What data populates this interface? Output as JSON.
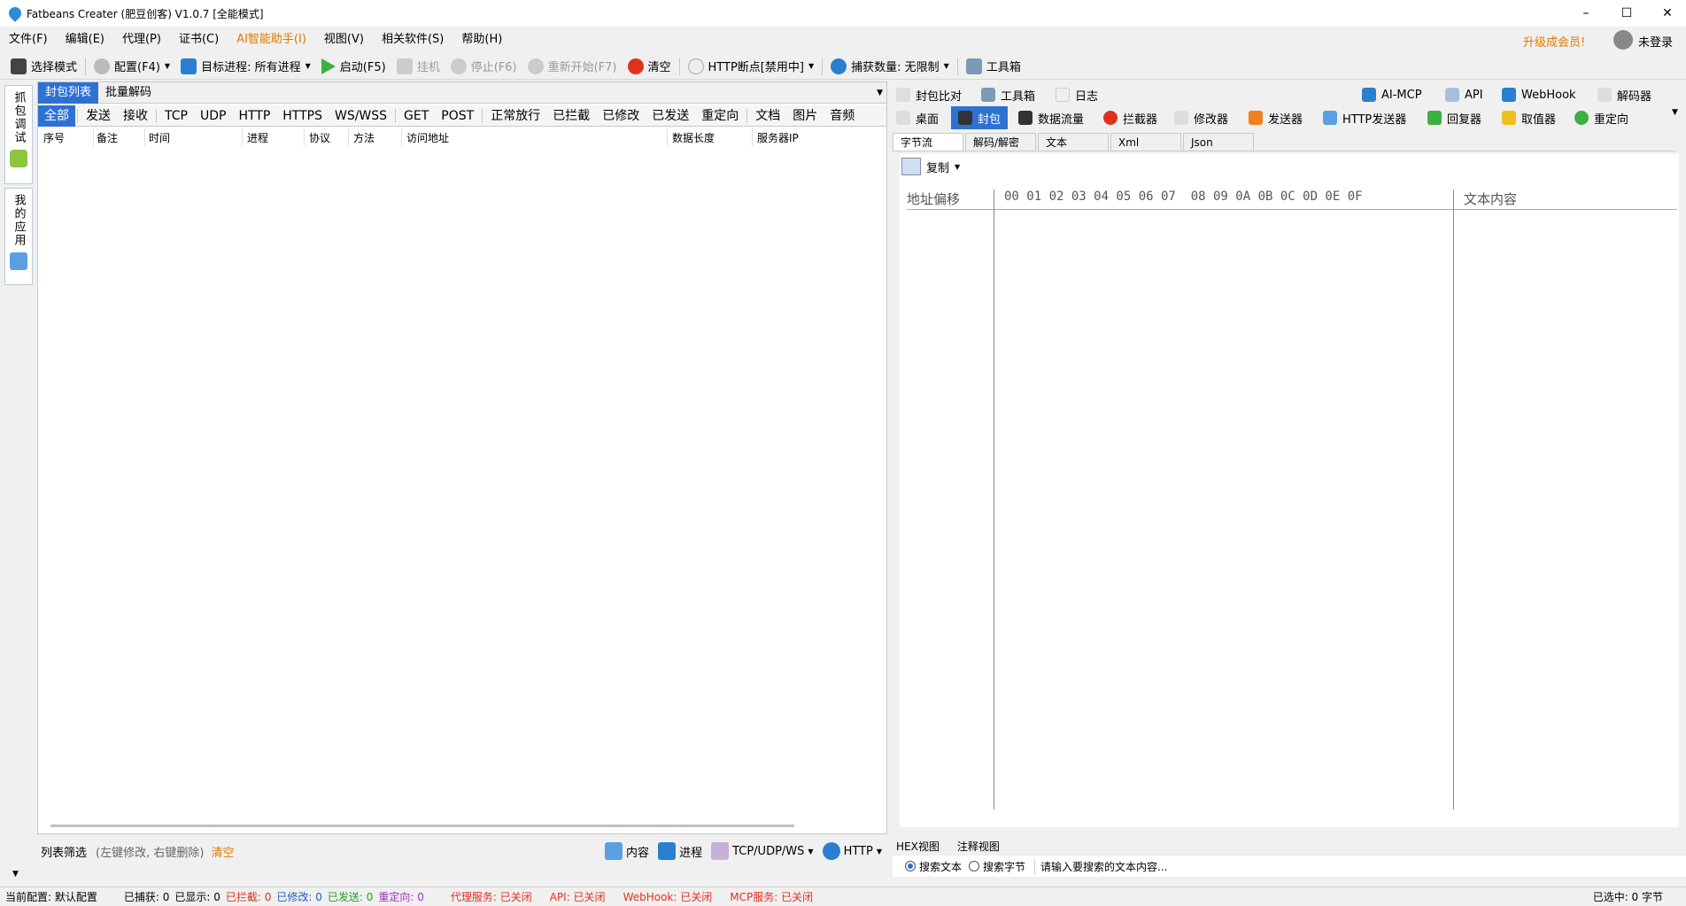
{
  "window": {
    "title": "Fatbeans Creater (肥豆创客) V1.0.7 [全能模式]",
    "min": "–",
    "max": "☐",
    "close": "✕"
  },
  "menu": {
    "items": [
      "文件(F)",
      "编辑(E)",
      "代理(P)",
      "证书(C)",
      "AI智能助手(I)",
      "视图(V)",
      "相关软件(S)",
      "帮助(H)"
    ],
    "upgrade": "升级成会员!",
    "login": "未登录"
  },
  "toolbar": {
    "select_mode": "选择模式",
    "config": "配置(F4)",
    "target_label": "目标进程:",
    "target_value": "所有进程",
    "start": "启动(F5)",
    "hang": "挂机",
    "stop": "停止(F6)",
    "restart": "重新开始(F7)",
    "clear": "清空",
    "http_bp": "HTTP断点[禁用中]",
    "capture_label": "捕获数量:",
    "capture_value": "无限制",
    "toolbox": "工具箱"
  },
  "sidebar": {
    "tab1": "抓包调试",
    "tab2": "我的应用"
  },
  "left": {
    "tabs": [
      "封包列表",
      "批量解码"
    ],
    "filters": [
      "全部",
      "发送",
      "接收",
      "TCP",
      "UDP",
      "HTTP",
      "HTTPS",
      "WS/WSS",
      "GET",
      "POST",
      "正常放行",
      "已拦截",
      "已修改",
      "已发送",
      "重定向",
      "文档",
      "图片",
      "音频"
    ],
    "columns": [
      "序号",
      "备注",
      "时间",
      "进程",
      "协议",
      "方法",
      "访问地址",
      "数据长度",
      "服务器IP"
    ]
  },
  "bottom_filter": {
    "label": "列表筛选",
    "hint": "(左键修改, 右键删除)",
    "clear": "清空",
    "content": "内容",
    "process": "进程",
    "tcp": "TCP/UDP/WS",
    "http": "HTTP"
  },
  "right": {
    "row1": [
      "封包比对",
      "工具箱",
      "日志",
      "AI-MCP",
      "API",
      "WebHook",
      "解码器"
    ],
    "row2": [
      "桌面",
      "封包",
      "数据流量",
      "拦截器",
      "修改器",
      "发送器",
      "HTTP发送器",
      "回复器",
      "取值器",
      "重定向"
    ],
    "tabs": [
      "字节流",
      "解码/解密",
      "文本",
      "Xml",
      "Json"
    ],
    "copy": "复制",
    "hex_header": {
      "addr": "地址偏移",
      "bytes": "00 01 02 03 04 05 06 07  08 09 0A 0B 0C 0D 0E 0F",
      "text": "文本内容"
    },
    "view_tabs": [
      "HEX视图",
      "注释视图"
    ],
    "search_text": "搜索文本",
    "search_bytes": "搜索字节",
    "search_placeholder": "请输入要搜索的文本内容..."
  },
  "status": {
    "config": "当前配置: 默认配置",
    "captured": "已捕获: 0",
    "shown": "已显示: 0",
    "intercepted": "已拦截: 0",
    "modified": "已修改: 0",
    "sent": "已发送: 0",
    "redirected": "重定向: 0",
    "proxy": "代理服务: 已关闭",
    "api": "API: 已关闭",
    "webhook": "WebHook: 已关闭",
    "mcp": "MCP服务: 已关闭",
    "selected": "已选中: 0 字节"
  }
}
